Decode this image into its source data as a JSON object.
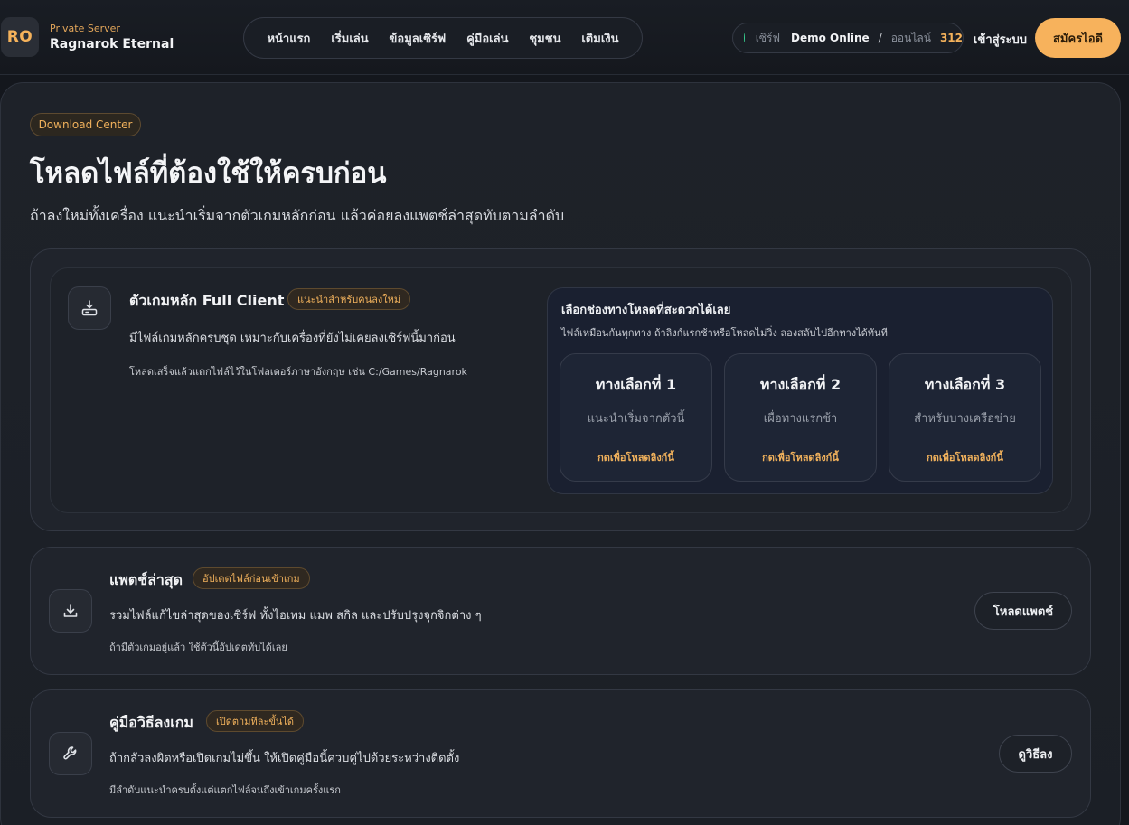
{
  "header": {
    "logo_text": "RO",
    "brand_sub": "Private Server",
    "brand_name": "Ragnarok Eternal",
    "nav": [
      "หน้าแรก",
      "เริ่มเล่น",
      "ข้อมูลเซิร์ฟ",
      "คู่มือเล่น",
      "ชุมชน",
      "เติมเงิน"
    ],
    "status": {
      "label": "เซิร์ฟ",
      "value": "Demo Online",
      "separator": "/",
      "online_label": "ออนไลน์",
      "online_count": "312",
      "dot_color": "#36c88a"
    },
    "login_label": "เข้าสู่ระบบ",
    "signup_label": "สมัครไอดี"
  },
  "hero": {
    "badge": "Download Center",
    "title": "โหลดไฟล์ที่ต้องใช้ให้ครบก่อน",
    "description": "ถ้าลงใหม่ทั้งเครื่อง แนะนำเริ่มจากตัวเกมหลักก่อน แล้วค่อยลงแพตช์ล่าสุดทับตามลำดับ"
  },
  "full_client": {
    "icon": "download-box-icon",
    "title": "ตัวเกมหลัก Full Client",
    "tag": "แนะนำสำหรับคนลงใหม่",
    "text": "มีไฟล์เกมหลักครบชุด เหมาะกับเครื่องที่ยังไม่เคยลงเซิร์ฟนี้มาก่อน",
    "note": "โหลดเสร็จแล้วแตกไฟล์ไว้ในโฟลเดอร์ภาษาอังกฤษ เช่น C:/Games/Ragnarok",
    "mirrors": {
      "title": "เลือกช่องทางโหลดที่สะดวกได้เลย",
      "description": "ไฟล์เหมือนกันทุกทาง ถ้าลิงก์แรกช้าหรือโหลดไม่วิ่ง ลองสลับไปอีกทางได้ทันที",
      "options": [
        {
          "title": "ทางเลือกที่ 1",
          "subtitle": "แนะนำเริ่มจากตัวนี้",
          "link": "กดเพื่อโหลดลิงก์นี้"
        },
        {
          "title": "ทางเลือกที่ 2",
          "subtitle": "เผื่อทางแรกช้า",
          "link": "กดเพื่อโหลดลิงก์นี้"
        },
        {
          "title": "ทางเลือกที่ 3",
          "subtitle": "สำหรับบางเครือข่าย",
          "link": "กดเพื่อโหลดลิงก์นี้"
        }
      ]
    }
  },
  "patch": {
    "icon": "download-icon",
    "title": "แพตช์ล่าสุด",
    "tag": "อัปเดตไฟล์ก่อนเข้าเกม",
    "text": "รวมไฟล์แก้ไขล่าสุดของเซิร์ฟ ทั้งไอเทม แมพ สกิล และปรับปรุงจุกจิกต่าง ๆ",
    "note": "ถ้ามีตัวเกมอยู่แล้ว ใช้ตัวนี้อัปเดตทับได้เลย",
    "button": "โหลดแพตช์"
  },
  "guide": {
    "icon": "wrench-icon",
    "title": "คู่มือวิธีลงเกม",
    "tag": "เปิดตามทีละขั้นได้",
    "text": "ถ้ากลัวลงผิดหรือเปิดเกมไม่ขึ้น ให้เปิดคู่มือนี้ควบคู่ไปด้วยระหว่างติดตั้ง",
    "note": "มีลำดับแนะนำครบตั้งแต่แตกไฟล์จนถึงเข้าเกมครั้งแรก",
    "button": "ดูวิธีลง"
  }
}
